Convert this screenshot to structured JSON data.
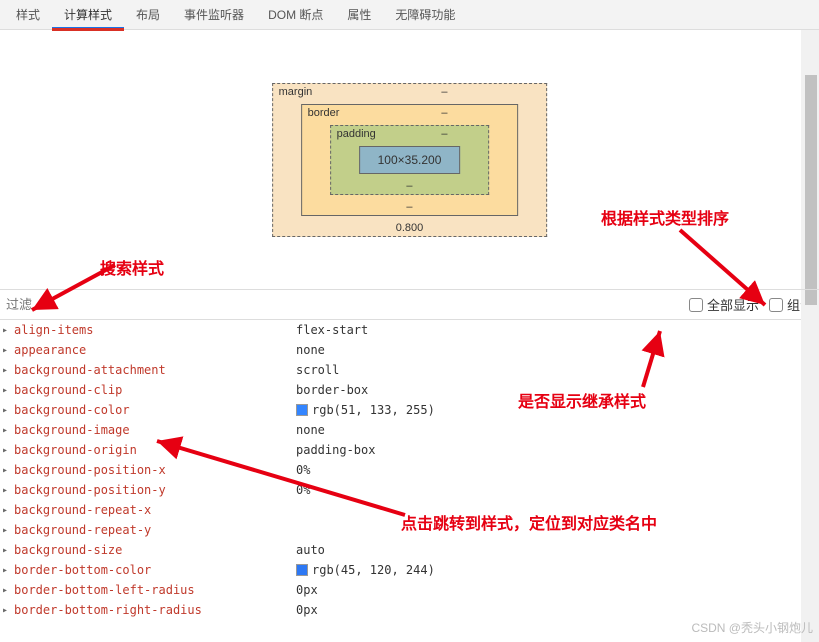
{
  "tabs": {
    "items": [
      {
        "label": "样式"
      },
      {
        "label": "计算样式"
      },
      {
        "label": "布局"
      },
      {
        "label": "事件监听器"
      },
      {
        "label": "DOM 断点"
      },
      {
        "label": "属性"
      },
      {
        "label": "无障碍功能"
      }
    ],
    "active_index": 1
  },
  "box_model": {
    "margin": {
      "label": "margin",
      "top": "–",
      "bottom": "0.800"
    },
    "border": {
      "label": "border",
      "top": "–",
      "bottom": "–"
    },
    "padding": {
      "label": "padding",
      "top": "–",
      "bottom": "–"
    },
    "content": "100×35.200"
  },
  "filter": {
    "placeholder": "过滤",
    "show_all_label": "全部显示",
    "group_label": "组合"
  },
  "properties": [
    {
      "name": "align-items",
      "value": "flex-start"
    },
    {
      "name": "appearance",
      "value": "none"
    },
    {
      "name": "background-attachment",
      "value": "scroll"
    },
    {
      "name": "background-clip",
      "value": "border-box"
    },
    {
      "name": "background-color",
      "value": "rgb(51, 133, 255)",
      "swatch": "#3385ff"
    },
    {
      "name": "background-image",
      "value": "none"
    },
    {
      "name": "background-origin",
      "value": "padding-box"
    },
    {
      "name": "background-position-x",
      "value": "0%"
    },
    {
      "name": "background-position-y",
      "value": "0%"
    },
    {
      "name": "background-repeat-x",
      "value": ""
    },
    {
      "name": "background-repeat-y",
      "value": ""
    },
    {
      "name": "background-size",
      "value": "auto"
    },
    {
      "name": "border-bottom-color",
      "value": "rgb(45, 120, 244)",
      "swatch": "#2d78f4"
    },
    {
      "name": "border-bottom-left-radius",
      "value": "0px"
    },
    {
      "name": "border-bottom-right-radius",
      "value": "0px"
    }
  ],
  "annotations": {
    "search": "搜索样式",
    "sort": "根据样式类型排序",
    "inherit": "是否显示继承样式",
    "jump": "点击跳转到样式，定位到对应类名中"
  },
  "watermark": "CSDN @秃头小钢炮儿"
}
